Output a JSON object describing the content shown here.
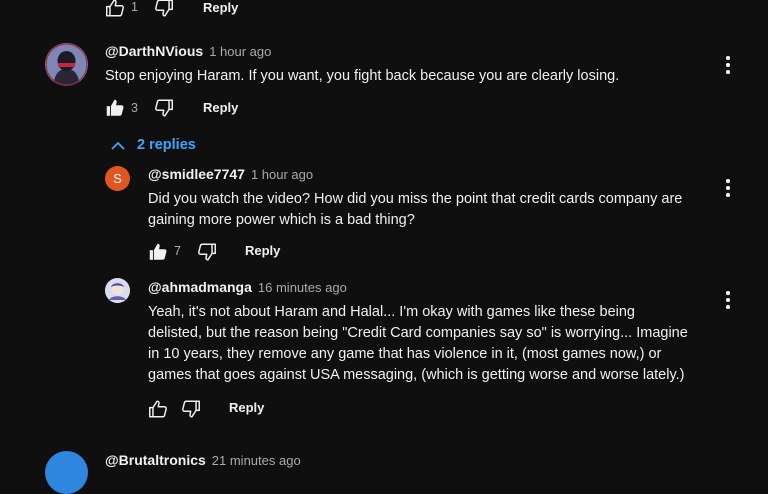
{
  "top_actions": {
    "like_count": "1",
    "reply_label": "Reply"
  },
  "comment": {
    "author": "@DarthNVious",
    "time": "1 hour ago",
    "text": "Stop enjoying Haram. If you want, you fight back because you are clearly losing.",
    "like_count": "3",
    "reply_label": "Reply",
    "replies_toggle": "2 replies"
  },
  "replies": [
    {
      "author": "@smidlee7747",
      "avatar_letter": "S",
      "avatar_color": "#e0561e",
      "time": "1 hour ago",
      "text_lines": [
        "Did you watch the video?  How did you miss the point that credit cards company are",
        "gaining more power which is a bad thing?"
      ],
      "like_count": "7",
      "reply_label": "Reply"
    },
    {
      "author": "@ahmadmanga",
      "time": "16 minutes ago",
      "text_lines": [
        "Yeah, it's not about Haram and Halal... I'm okay with games like these being",
        "delisted, but the reason being \"Credit Card companies say so\" is worrying... Imagine",
        "in 10 years, they remove any game that has violence in it, (most games now,) or",
        "games that goes against USA messaging, (which is getting worse and worse lately.)"
      ],
      "reply_label": "Reply"
    }
  ],
  "next_comment": {
    "author": "@Brutaltronics",
    "time": "21 minutes ago"
  },
  "colors": {
    "background": "#0f0f0f",
    "link": "#3ea6ff",
    "muted": "#aaaaaa"
  }
}
